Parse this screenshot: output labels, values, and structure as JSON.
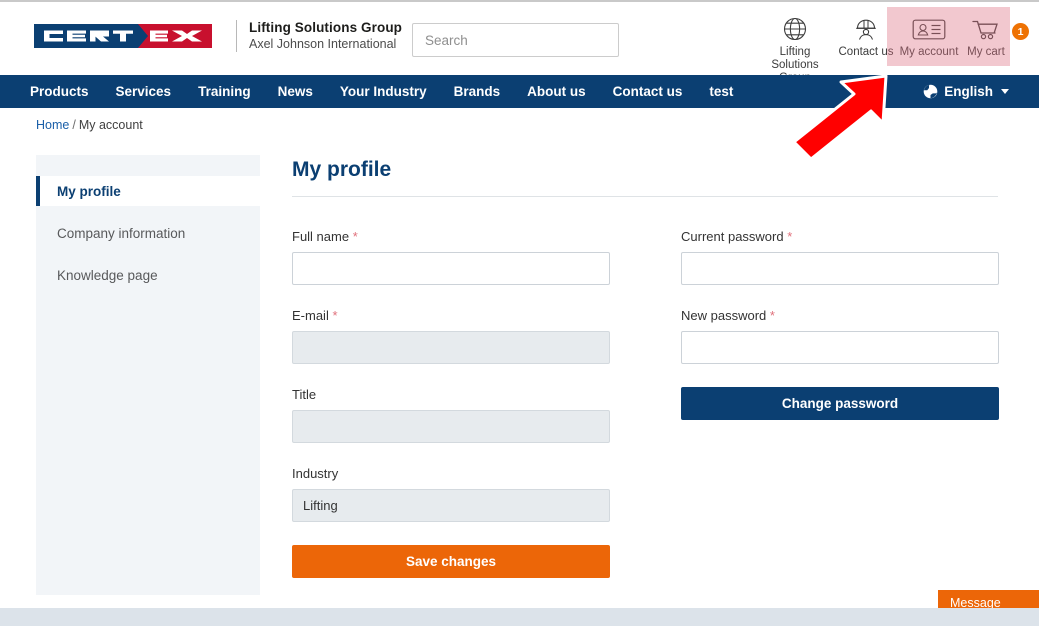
{
  "brand": {
    "logo_primary": "CERT",
    "logo_secondary": "EX",
    "tagline_line1": "Lifting Solutions Group",
    "tagline_line2": "Axel Johnson International",
    "navy": "#0b3f72",
    "red": "#c8102e",
    "orange": "#ec6608"
  },
  "search": {
    "placeholder": "Search",
    "value": ""
  },
  "header": {
    "utilities": [
      {
        "icon": "globe-icon",
        "label": "Lifting Solutions Group"
      },
      {
        "icon": "worker-icon",
        "label": "Contact us"
      },
      {
        "icon": "id-card-icon",
        "label": "My account"
      },
      {
        "icon": "cart-icon",
        "label": "My cart",
        "badge": "1"
      }
    ]
  },
  "nav": {
    "items": [
      {
        "label": "Products"
      },
      {
        "label": "Services"
      },
      {
        "label": "Training"
      },
      {
        "label": "News"
      },
      {
        "label": "Your Industry"
      },
      {
        "label": "Brands"
      },
      {
        "label": "About us"
      },
      {
        "label": "Contact us"
      },
      {
        "label": "test"
      }
    ],
    "language": "English"
  },
  "breadcrumb": {
    "home": "Home",
    "separator": "/",
    "current": "My account"
  },
  "sidebar": {
    "items": [
      {
        "label": "My profile",
        "active": true
      },
      {
        "label": "Company information",
        "active": false
      },
      {
        "label": "Knowledge page",
        "active": false
      }
    ]
  },
  "main": {
    "title": "My profile",
    "left_column": {
      "fields": [
        {
          "label": "Full name",
          "required": true,
          "value": "",
          "disabled": false
        },
        {
          "label": "E-mail",
          "required": true,
          "value": "",
          "disabled": true
        },
        {
          "label": "Title",
          "required": false,
          "value": "",
          "disabled": true
        },
        {
          "label": "Industry",
          "required": false,
          "value": "Lifting",
          "disabled": true
        }
      ],
      "save_label": "Save changes"
    },
    "right_column": {
      "fields": [
        {
          "label": "Current password",
          "required": true,
          "value": "",
          "disabled": false
        },
        {
          "label": "New password",
          "required": true,
          "value": "",
          "disabled": false
        }
      ],
      "change_password_label": "Change password"
    },
    "required_marker": "*"
  },
  "annotation": {
    "shape": "red-arrow-pointing-up-right",
    "color": "#ff0000",
    "points_to": "My account"
  },
  "chat": {
    "label": "Message"
  }
}
